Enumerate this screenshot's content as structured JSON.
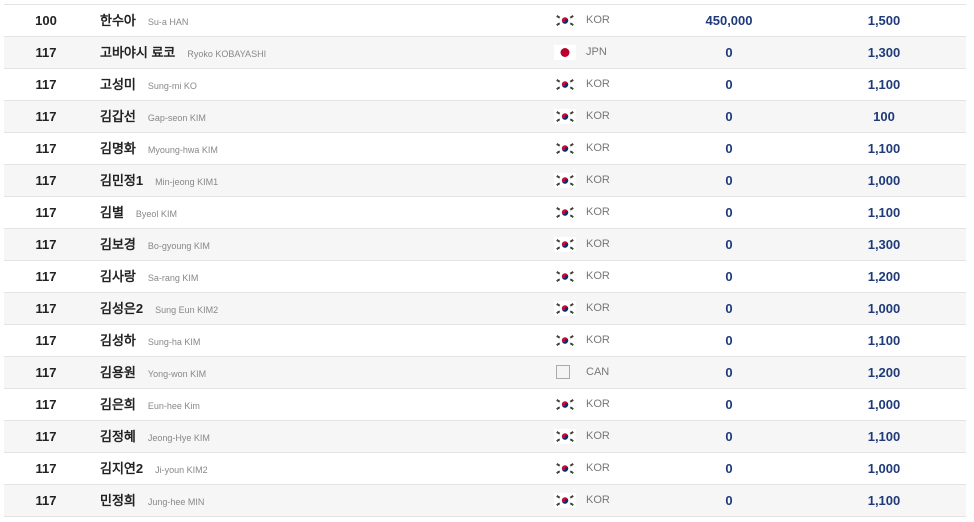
{
  "rows": [
    {
      "rank": "100",
      "name_kr": "한수아",
      "name_en": "Su-a HAN",
      "flag": "kor-flag-icon",
      "nation": "KOR",
      "points": "450,000",
      "prize": "1,500"
    },
    {
      "rank": "117",
      "name_kr": "고바야시 료코",
      "name_en": "Ryoko KOBAYASHI",
      "flag": "jpn-flag-icon",
      "nation": "JPN",
      "points": "0",
      "prize": "1,300"
    },
    {
      "rank": "117",
      "name_kr": "고성미",
      "name_en": "Sung-mi KO",
      "flag": "kor-flag-icon",
      "nation": "KOR",
      "points": "0",
      "prize": "1,100"
    },
    {
      "rank": "117",
      "name_kr": "김갑선",
      "name_en": "Gap-seon KIM",
      "flag": "kor-flag-icon",
      "nation": "KOR",
      "points": "0",
      "prize": "100"
    },
    {
      "rank": "117",
      "name_kr": "김명화",
      "name_en": "Myoung-hwa KIM",
      "flag": "kor-flag-icon",
      "nation": "KOR",
      "points": "0",
      "prize": "1,100"
    },
    {
      "rank": "117",
      "name_kr": "김민정1",
      "name_en": "Min-jeong KIM1",
      "flag": "kor-flag-icon",
      "nation": "KOR",
      "points": "0",
      "prize": "1,000"
    },
    {
      "rank": "117",
      "name_kr": "김별",
      "name_en": "Byeol KIM",
      "flag": "kor-flag-icon",
      "nation": "KOR",
      "points": "0",
      "prize": "1,100"
    },
    {
      "rank": "117",
      "name_kr": "김보경",
      "name_en": "Bo-gyoung KIM",
      "flag": "kor-flag-icon",
      "nation": "KOR",
      "points": "0",
      "prize": "1,300"
    },
    {
      "rank": "117",
      "name_kr": "김사랑",
      "name_en": "Sa-rang KIM",
      "flag": "kor-flag-icon",
      "nation": "KOR",
      "points": "0",
      "prize": "1,200"
    },
    {
      "rank": "117",
      "name_kr": "김성은2",
      "name_en": "Sung Eun KIM2",
      "flag": "kor-flag-icon",
      "nation": "KOR",
      "points": "0",
      "prize": "1,000"
    },
    {
      "rank": "117",
      "name_kr": "김성하",
      "name_en": "Sung-ha KIM",
      "flag": "kor-flag-icon",
      "nation": "KOR",
      "points": "0",
      "prize": "1,100"
    },
    {
      "rank": "117",
      "name_kr": "김용원",
      "name_en": "Yong-won KIM",
      "flag": "broken-image-icon",
      "nation": "CAN",
      "points": "0",
      "prize": "1,200"
    },
    {
      "rank": "117",
      "name_kr": "김은희",
      "name_en": "Eun-hee Kim",
      "flag": "kor-flag-icon",
      "nation": "KOR",
      "points": "0",
      "prize": "1,000"
    },
    {
      "rank": "117",
      "name_kr": "김정혜",
      "name_en": "Jeong-Hye KIM",
      "flag": "kor-flag-icon",
      "nation": "KOR",
      "points": "0",
      "prize": "1,100"
    },
    {
      "rank": "117",
      "name_kr": "김지연2",
      "name_en": "Ji-youn KIM2",
      "flag": "kor-flag-icon",
      "nation": "KOR",
      "points": "0",
      "prize": "1,000"
    },
    {
      "rank": "117",
      "name_kr": "민정희",
      "name_en": "Jung-hee MIN",
      "flag": "kor-flag-icon",
      "nation": "KOR",
      "points": "0",
      "prize": "1,100"
    }
  ]
}
